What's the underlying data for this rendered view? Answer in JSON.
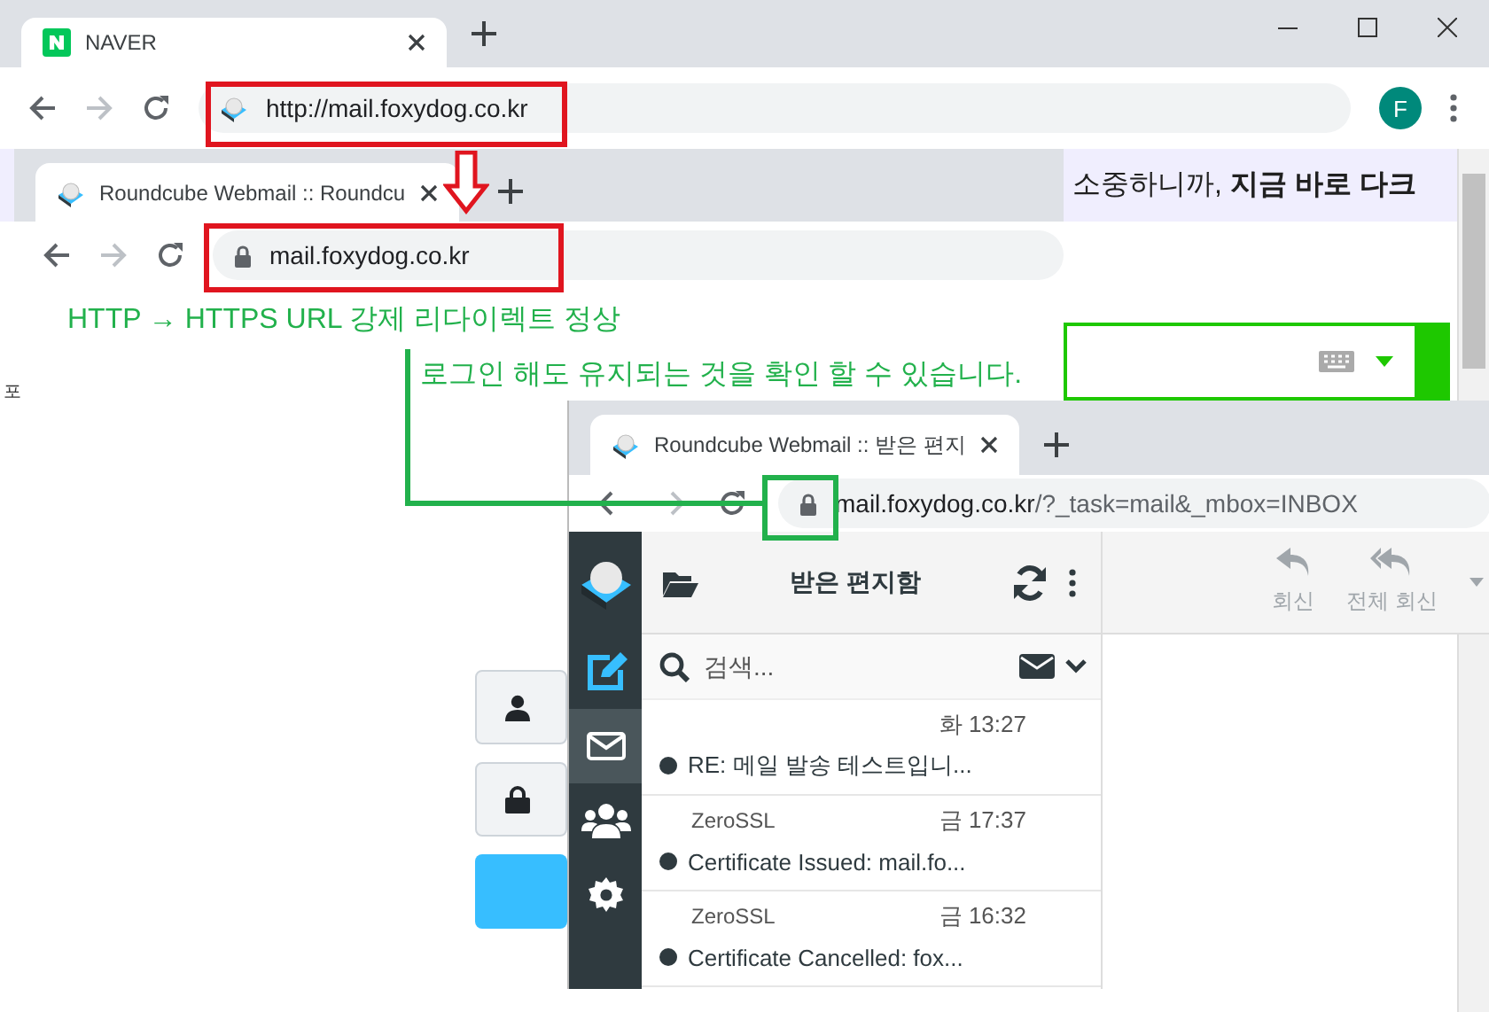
{
  "back_window": {
    "tab": {
      "title": "NAVER",
      "selected": true
    },
    "address": "http://mail.foxydog.co.kr",
    "secure": false,
    "profile_initial": "F",
    "banner": "소중하니까, **지금 바로 다크**",
    "side_text": "포"
  },
  "middle_window": {
    "tab": {
      "title": "Roundcube Webmail :: Roundcu",
      "selected": true
    },
    "address": "mail.foxydog.co.kr",
    "secure": true
  },
  "annotations": [
    {
      "text": "HTTP → HTTPS URL 강제 리다이렉트 정상"
    },
    {
      "text": "로그인 해도 유지되는 것을 확인 할 수 있습니다."
    }
  ],
  "front_window": {
    "tab": {
      "title": "Roundcube Webmail :: 받은 편지",
      "selected": true
    },
    "address_host": "mail.foxydog.co.kr",
    "address_path": "/?_task=mail&_mbox=INBOX",
    "secure": true,
    "nav": [
      {
        "kind": "compose",
        "selected": false
      },
      {
        "kind": "mail",
        "selected": true
      },
      {
        "kind": "contacts",
        "selected": false
      },
      {
        "kind": "settings",
        "selected": false
      }
    ],
    "folder_title": "받은 편지함",
    "search": {
      "placeholder": "검색..."
    },
    "messages": [
      {
        "date": "화 13:27",
        "subject": "RE: 메일 발송 테스트입니...",
        "unread": true
      },
      {
        "sender": "ZeroSSL",
        "date": "금 17:37",
        "subject": "Certificate Issued: mail.fo...",
        "unread": true
      },
      {
        "sender": "ZeroSSL",
        "date": "금 16:32",
        "subject": "Certificate Cancelled: fox...",
        "unread": true
      }
    ],
    "actions": [
      {
        "kind": "reply",
        "label": "회신",
        "disabled": true
      },
      {
        "kind": "reply-all",
        "label": "전체 회신",
        "disabled": true
      }
    ]
  }
}
